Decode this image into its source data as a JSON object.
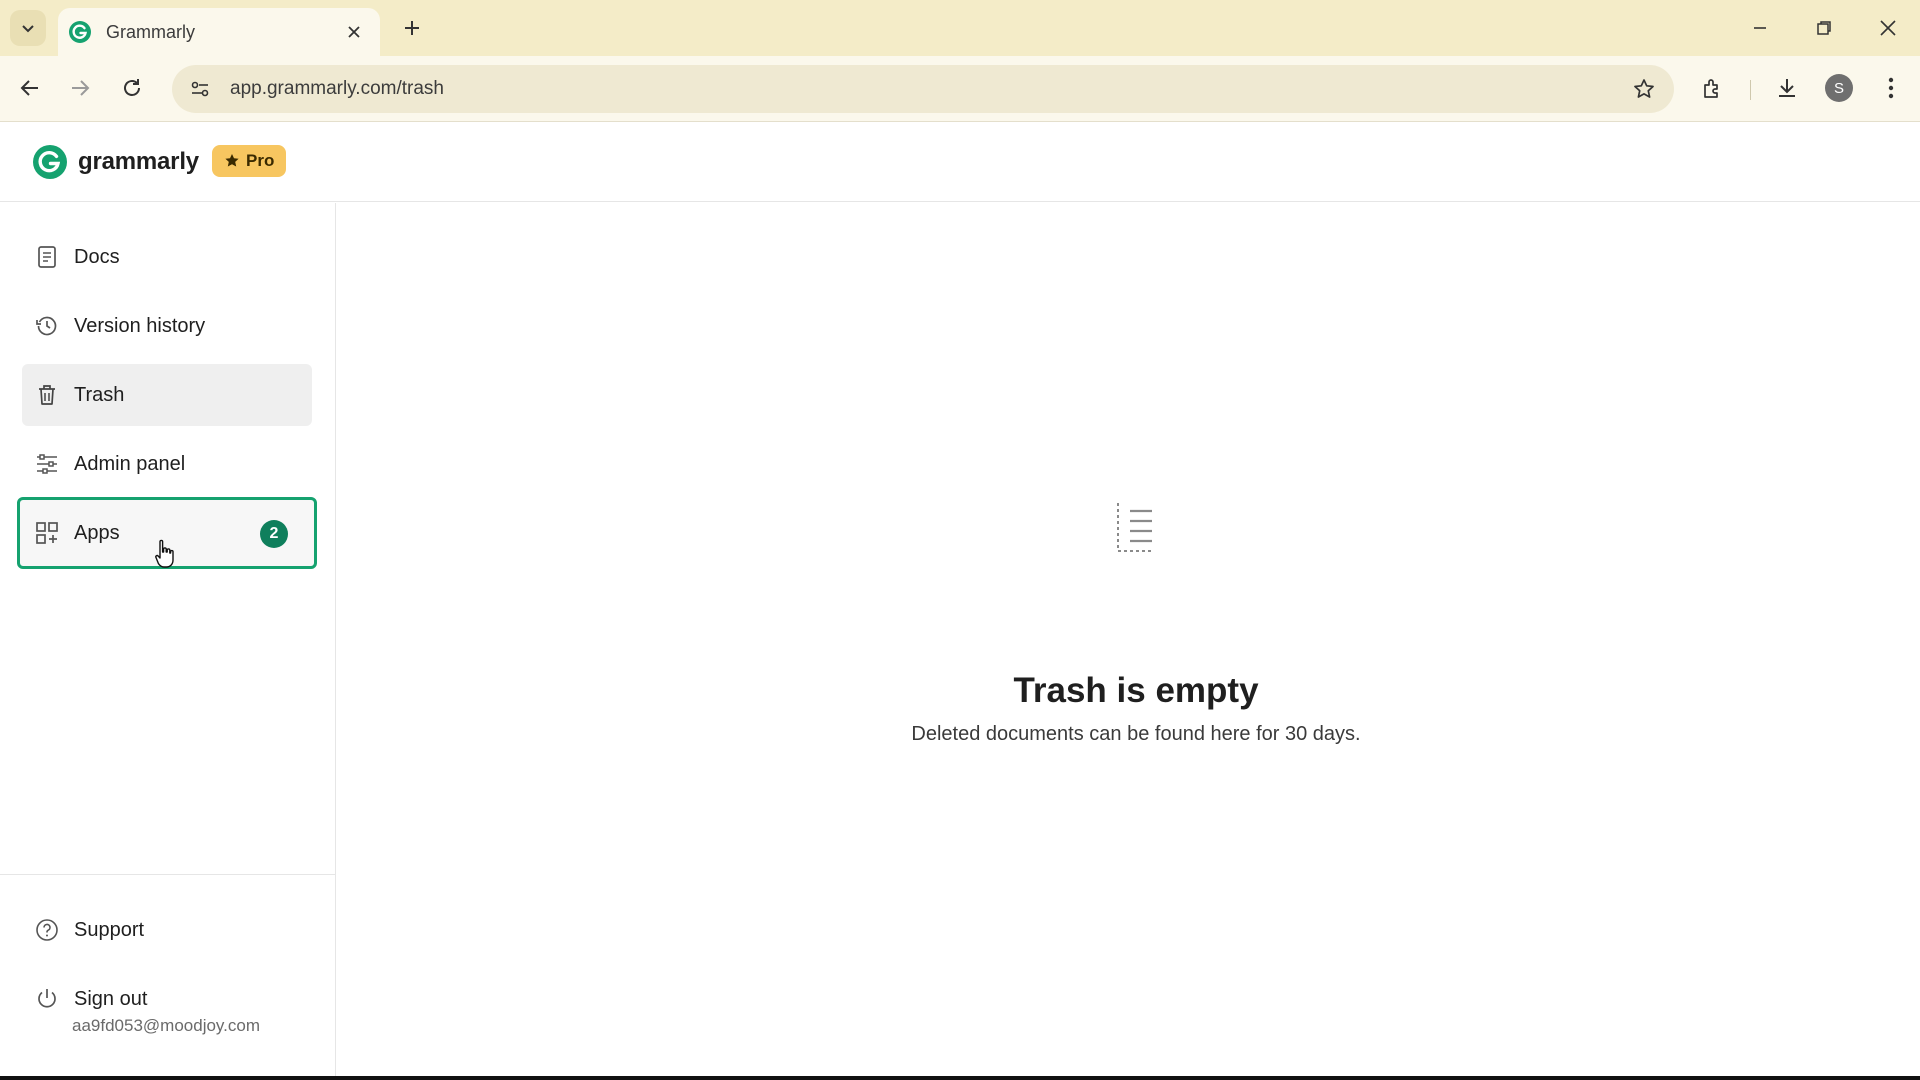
{
  "browser": {
    "tab_title": "Grammarly",
    "url": "app.grammarly.com/trash",
    "profile_initial": "S",
    "icons": [
      "chevron-down-icon",
      "grammarly-favicon",
      "close-icon",
      "plus-icon",
      "minimize-icon",
      "restore-icon",
      "close-window-icon",
      "back-arrow-icon",
      "forward-arrow-icon",
      "reload-icon",
      "site-info-icon",
      "star-icon",
      "extensions-icon",
      "download-icon",
      "more-vert-icon"
    ]
  },
  "header": {
    "logo_text": "grammarly",
    "pro_label": "Pro"
  },
  "sidebar": {
    "items": [
      {
        "label": "Docs",
        "icon": "document-icon"
      },
      {
        "label": "Version history",
        "icon": "history-icon"
      },
      {
        "label": "Trash",
        "icon": "trash-icon"
      },
      {
        "label": "Admin panel",
        "icon": "sliders-icon"
      },
      {
        "label": "Apps",
        "icon": "apps-grid-icon",
        "badge": "2"
      }
    ],
    "footer": {
      "support_label": "Support",
      "sign_out_label": "Sign out",
      "email": "aa9fd053@moodjoy.com"
    }
  },
  "main": {
    "empty_title": "Trash is empty",
    "empty_subtitle": "Deleted documents can be found here for 30 days."
  },
  "colors": {
    "brand_green": "#15a26f",
    "badge_green": "#0f7f5c",
    "pro_yellow": "#f7c660",
    "chrome_bg": "#f4ecc8"
  }
}
